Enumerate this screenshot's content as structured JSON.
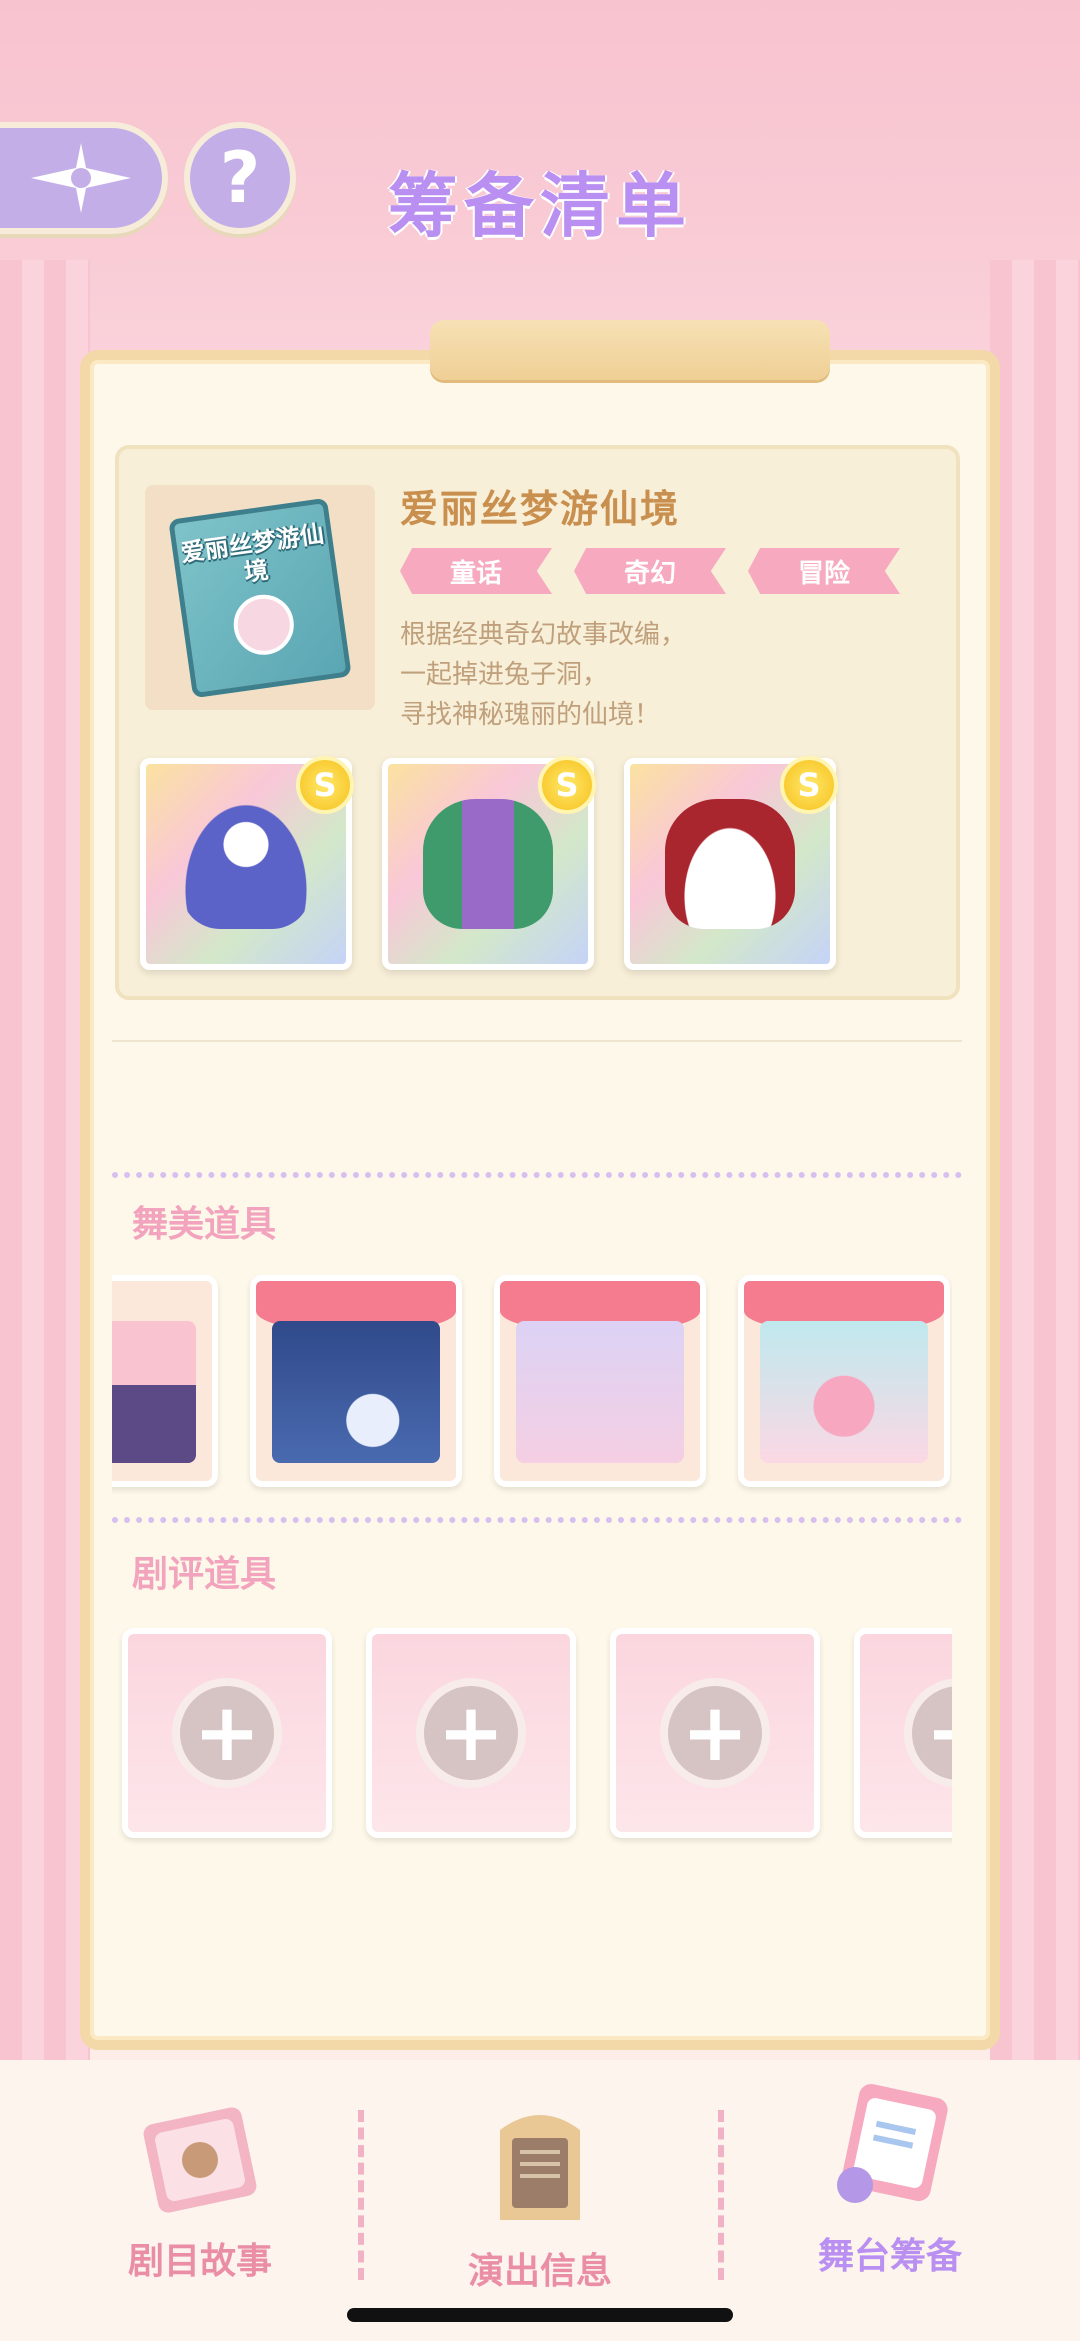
{
  "header": {
    "title": "筹备清单",
    "help_symbol": "?"
  },
  "story": {
    "cover_text": "爱丽丝梦游仙境",
    "title": "爱丽丝梦游仙境",
    "tags": [
      "童话",
      "奇幻",
      "冒险"
    ],
    "description_lines": [
      "根据经典奇幻故事改编，",
      "一起掉进兔子洞，",
      "寻找神秘瑰丽的仙境！"
    ],
    "outfits": [
      {
        "rank": "S",
        "icon": "blue-dress-icon"
      },
      {
        "rank": "S",
        "icon": "green-suit-icon"
      },
      {
        "rank": "S",
        "icon": "bunny-hat-icon"
      }
    ]
  },
  "sections": {
    "stage_props_label": "舞美道具",
    "stage_props": [
      {
        "icon": "night-town-scene-icon"
      },
      {
        "icon": "moon-night-stage-icon"
      },
      {
        "icon": "card-castle-stage-icon"
      },
      {
        "icon": "heart-cake-stage-icon"
      }
    ],
    "review_props_label": "剧评道具",
    "review_slots": [
      {
        "symbol": "+"
      },
      {
        "symbol": "+"
      },
      {
        "symbol": "+"
      },
      {
        "symbol": "+"
      }
    ]
  },
  "bottom_nav": {
    "items": [
      {
        "label": "剧目故事",
        "icon": "story-book-icon",
        "active": false
      },
      {
        "label": "演出信息",
        "icon": "info-board-icon",
        "active": false
      },
      {
        "label": "舞台筹备",
        "icon": "clipboard-icon",
        "active": true
      }
    ]
  },
  "colors": {
    "accent_purple": "#b98ff1",
    "tag_pink": "#f6a9bf",
    "title_gold": "#c98f4f"
  }
}
